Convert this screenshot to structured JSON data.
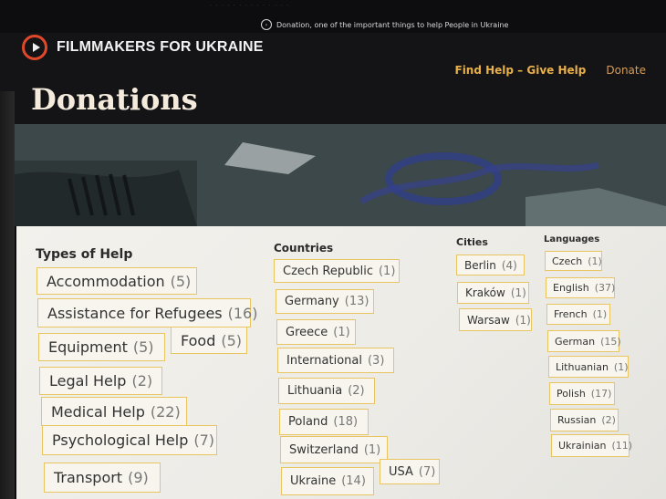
{
  "notice": "Donation, one of the important things to help People in Ukraine",
  "brand": {
    "name": "FILMMAKERS FOR UKRAINE"
  },
  "nav": {
    "find_help": "Find Help – Give Help",
    "donate": "Donate"
  },
  "page": {
    "title": "Donations"
  },
  "types_of_help": {
    "heading": "Types of Help",
    "items": [
      {
        "label": "Accommodation",
        "count": "(5)"
      },
      {
        "label": "Assistance for Refugees",
        "count": "(16)"
      },
      {
        "label": "Equipment",
        "count": "(5)"
      },
      {
        "label": "Food",
        "count": "(5)"
      },
      {
        "label": "Legal Help",
        "count": "(2)"
      },
      {
        "label": "Medical Help",
        "count": "(22)"
      },
      {
        "label": "Psychological Help",
        "count": "(7)"
      },
      {
        "label": "Transport",
        "count": "(9)"
      }
    ]
  },
  "countries": {
    "heading": "Countries",
    "items": [
      {
        "label": "Czech Republic",
        "count": "(1)"
      },
      {
        "label": "Germany",
        "count": "(13)"
      },
      {
        "label": "Greece",
        "count": "(1)"
      },
      {
        "label": "International",
        "count": "(3)"
      },
      {
        "label": "Lithuania",
        "count": "(2)"
      },
      {
        "label": "Poland",
        "count": "(18)"
      },
      {
        "label": "Switzerland",
        "count": "(1)"
      },
      {
        "label": "Ukraine",
        "count": "(14)"
      },
      {
        "label": "USA",
        "count": "(7)"
      }
    ]
  },
  "cities": {
    "heading": "Cities",
    "items": [
      {
        "label": "Berlin",
        "count": "(4)"
      },
      {
        "label": "Kraków",
        "count": "(1)"
      },
      {
        "label": "Warsaw",
        "count": "(1)"
      }
    ]
  },
  "languages": {
    "heading": "Languages",
    "items": [
      {
        "label": "Czech",
        "count": "(1)"
      },
      {
        "label": "English",
        "count": "(37)"
      },
      {
        "label": "French",
        "count": "(1)"
      },
      {
        "label": "German",
        "count": "(15)"
      },
      {
        "label": "Lithuanian",
        "count": "(1)"
      },
      {
        "label": "Polish",
        "count": "(17)"
      },
      {
        "label": "Russian",
        "count": "(2)"
      },
      {
        "label": "Ukrainian",
        "count": "(11)"
      }
    ]
  }
}
